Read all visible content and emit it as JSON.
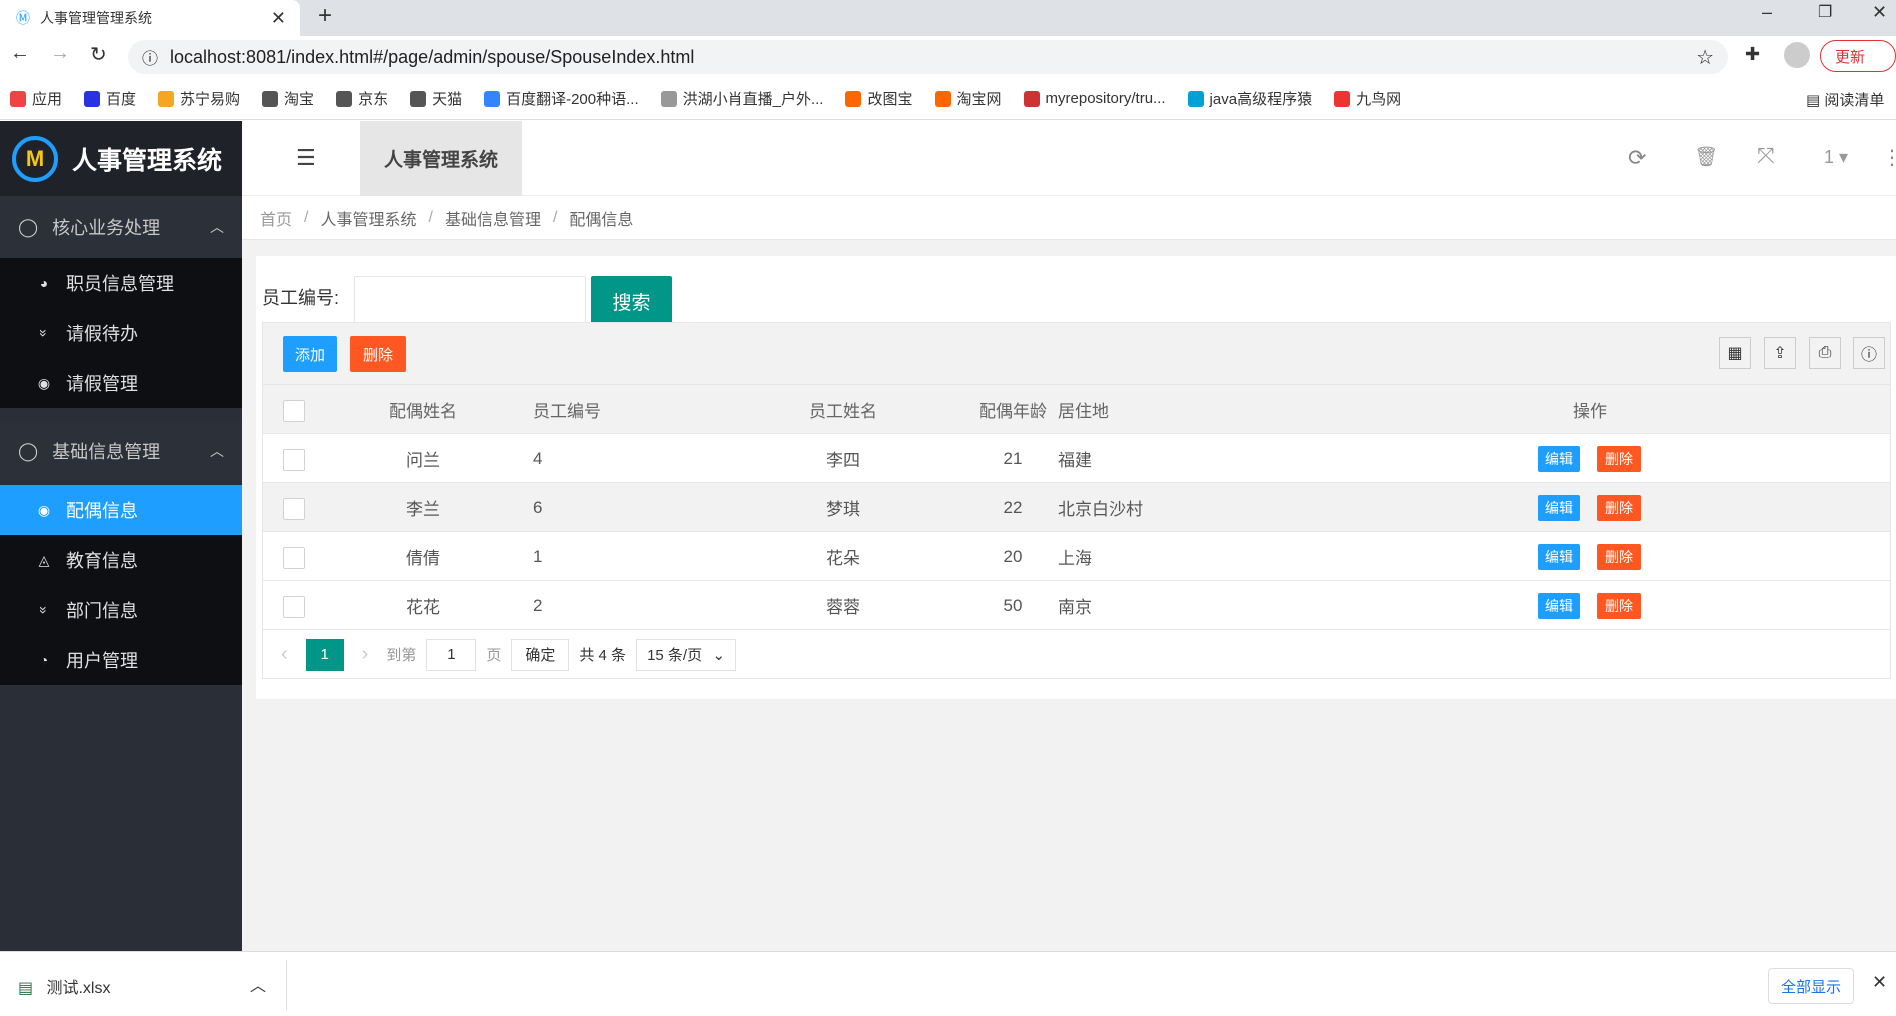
{
  "browser": {
    "tab_title": "人事管理管理系统",
    "url": "localhost:8081/index.html#/page/admin/spouse/SpouseIndex.html",
    "update_label": "更新",
    "bookmarks": [
      {
        "label": "应用",
        "color": "#e44"
      },
      {
        "label": "百度",
        "color": "#2932e1"
      },
      {
        "label": "苏宁易购",
        "color": "#f5a623"
      },
      {
        "label": "淘宝",
        "color": "#555"
      },
      {
        "label": "京东",
        "color": "#555"
      },
      {
        "label": "天猫",
        "color": "#555"
      },
      {
        "label": "百度翻译-200种语...",
        "color": "#3385ff"
      },
      {
        "label": "洪湖小肖直播_户外...",
        "color": "#999"
      },
      {
        "label": "改图宝",
        "color": "#f60"
      },
      {
        "label": "淘宝网",
        "color": "#f60"
      },
      {
        "label": "myrepository/tru...",
        "color": "#c33"
      },
      {
        "label": "java高级程序猿",
        "color": "#00a1d6"
      },
      {
        "label": "九鸟网",
        "color": "#e33"
      }
    ],
    "reading_list": "阅读清单"
  },
  "app": {
    "title": "人事管理系统",
    "header_tab": "人事管理系统",
    "page_num": "1"
  },
  "sidebar": {
    "groups": [
      {
        "label": "核心业务处理",
        "items": [
          {
            "label": "职员信息管理",
            "icon": "dashboard-icon"
          },
          {
            "label": "请假待办",
            "icon": "chevrons-down-icon"
          },
          {
            "label": "请假管理",
            "icon": "target-icon"
          }
        ]
      },
      {
        "label": "基础信息管理",
        "items": [
          {
            "label": "配偶信息",
            "icon": "target-icon",
            "active": true
          },
          {
            "label": "教育信息",
            "icon": "triangle-circle-icon"
          },
          {
            "label": "部门信息",
            "icon": "chevrons-down-icon"
          },
          {
            "label": "用户管理",
            "icon": "user-circle-icon"
          }
        ]
      }
    ]
  },
  "breadcrumb": [
    "首页",
    "人事管理系统",
    "基础信息管理",
    "配偶信息"
  ],
  "search": {
    "label": "员工编号:",
    "value": "",
    "button": "搜索"
  },
  "table": {
    "add_label": "添加",
    "delete_label": "删除",
    "columns": [
      "配偶姓名",
      "员工编号",
      "员工姓名",
      "配偶年龄",
      "居住地",
      "操作"
    ],
    "rows": [
      [
        "问兰",
        "4",
        "李四",
        "21",
        "福建"
      ],
      [
        "李兰",
        "6",
        "梦琪",
        "22",
        "北京白沙村"
      ],
      [
        "倩倩",
        "1",
        "花朵",
        "20",
        "上海"
      ],
      [
        "花花",
        "2",
        "蓉蓉",
        "50",
        "南京"
      ]
    ],
    "edit_label": "编辑",
    "row_delete_label": "删除"
  },
  "pager": {
    "current": "1",
    "goto_label": "到第",
    "goto_value": "1",
    "page_suffix": "页",
    "confirm": "确定",
    "total": "共 4 条",
    "page_size": "15 条/页"
  },
  "download": {
    "file": "测试.xlsx",
    "show_all": "全部显示"
  },
  "colors": {
    "accent": "#1e9fff",
    "primary": "#009688",
    "danger": "#ff5722"
  }
}
